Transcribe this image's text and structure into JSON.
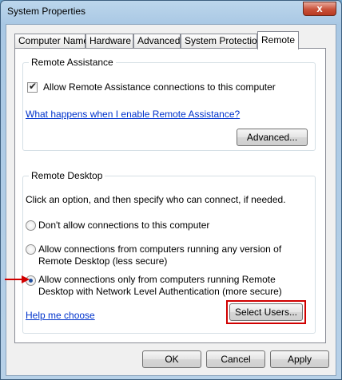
{
  "window": {
    "title": "System Properties",
    "close_label": "x"
  },
  "tabs": [
    {
      "label": "Computer Name"
    },
    {
      "label": "Hardware"
    },
    {
      "label": "Advanced"
    },
    {
      "label": "System Protection"
    },
    {
      "label": "Remote"
    }
  ],
  "remote_assistance": {
    "group_label": "Remote Assistance",
    "allow_checkbox_label": "Allow Remote Assistance connections to this computer",
    "allow_checked": true,
    "help_link": "What happens when I enable Remote Assistance?",
    "advanced_button": "Advanced..."
  },
  "remote_desktop": {
    "group_label": "Remote Desktop",
    "instructions": "Click an option, and then specify who can connect, if needed.",
    "option_dont_allow": "Don't allow connections to this computer",
    "option_any_line1": "Allow connections from computers running any version of",
    "option_any_line2": "Remote Desktop (less secure)",
    "option_nla_line1": "Allow connections only from computers running Remote",
    "option_nla_line2": "Desktop with Network Level Authentication (more secure)",
    "selected_option": "nla",
    "help_link": "Help me choose",
    "select_users_button": "Select Users..."
  },
  "footer": {
    "ok": "OK",
    "cancel": "Cancel",
    "apply": "Apply"
  },
  "colors": {
    "annotation_red": "#d00000",
    "link_blue": "#0033cc"
  }
}
